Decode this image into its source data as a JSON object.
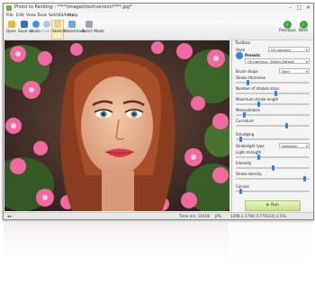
{
  "window": {
    "title": "Photo to Painting - ****\\Images\\test\\version****.jpg*",
    "controls": {
      "minimize": "–",
      "maximize": "□",
      "close": "✕"
    }
  },
  "menu": [
    "File",
    "Edit",
    "View",
    "Tools",
    "Sel/Util/Help",
    "Help"
  ],
  "toolbar": {
    "buttons": [
      {
        "label": "Open",
        "icon": "folder-open-icon"
      },
      {
        "label": "Save as..",
        "icon": "save-icon"
      },
      {
        "label": "Undo",
        "icon": "undo-icon"
      },
      {
        "label": "Redo",
        "icon": "redo-icon"
      },
      {
        "label": "Sketch",
        "icon": "sketch-icon"
      },
      {
        "label": "Watermark",
        "icon": "watermark-icon"
      },
      {
        "label": "Batch Mode",
        "icon": "batch-icon"
      }
    ],
    "previous": "Previous",
    "next": "Next"
  },
  "panel": {
    "title": "Toolbox",
    "style_label": "Style",
    "style_value": "Oil painting",
    "presets_label": "Presets",
    "preset_value": "Oil painting - Detail Default",
    "brush_shape_label": "Brush shape",
    "brush_shape_value": "Nine",
    "stroke_thickness_label": "Stroke thickness",
    "number_of_strokes_label": "Number of strokes sizes",
    "maximum_stroke_length_label": "Maximum stroke length",
    "messy_label": "Messystrokes",
    "curvature_label": "Curvature",
    "smudging_label": "Smudging",
    "stroke_light_type_label": "Strokelight type",
    "stroke_light_type_value": "Direction",
    "light_strength_label": "Light strength",
    "intensity_label": "Intensity",
    "stroke_density_label": "Stroke density",
    "canvas_label": "Canvas",
    "run_label": "Run",
    "sliders": {
      "stroke_thickness": 0.15,
      "number_of_strokes": 0.55,
      "maximum_stroke_length": 0.3,
      "messy": 0.1,
      "curvature": 0.7,
      "smudging": 0.05,
      "light_strength": 0.3,
      "intensity": 0.5,
      "stroke_density": 0.95,
      "canvas": 0.05
    }
  },
  "statusbar": {
    "left": "◂◂",
    "time": "Time ms: 14419",
    "format": "JPG",
    "info": "1296 x 1794 (1779124) 2.5%"
  },
  "colors": {
    "accent": "#3a7fd5",
    "run_button": "#c8e08a",
    "nav_green": "#3fa33f"
  }
}
